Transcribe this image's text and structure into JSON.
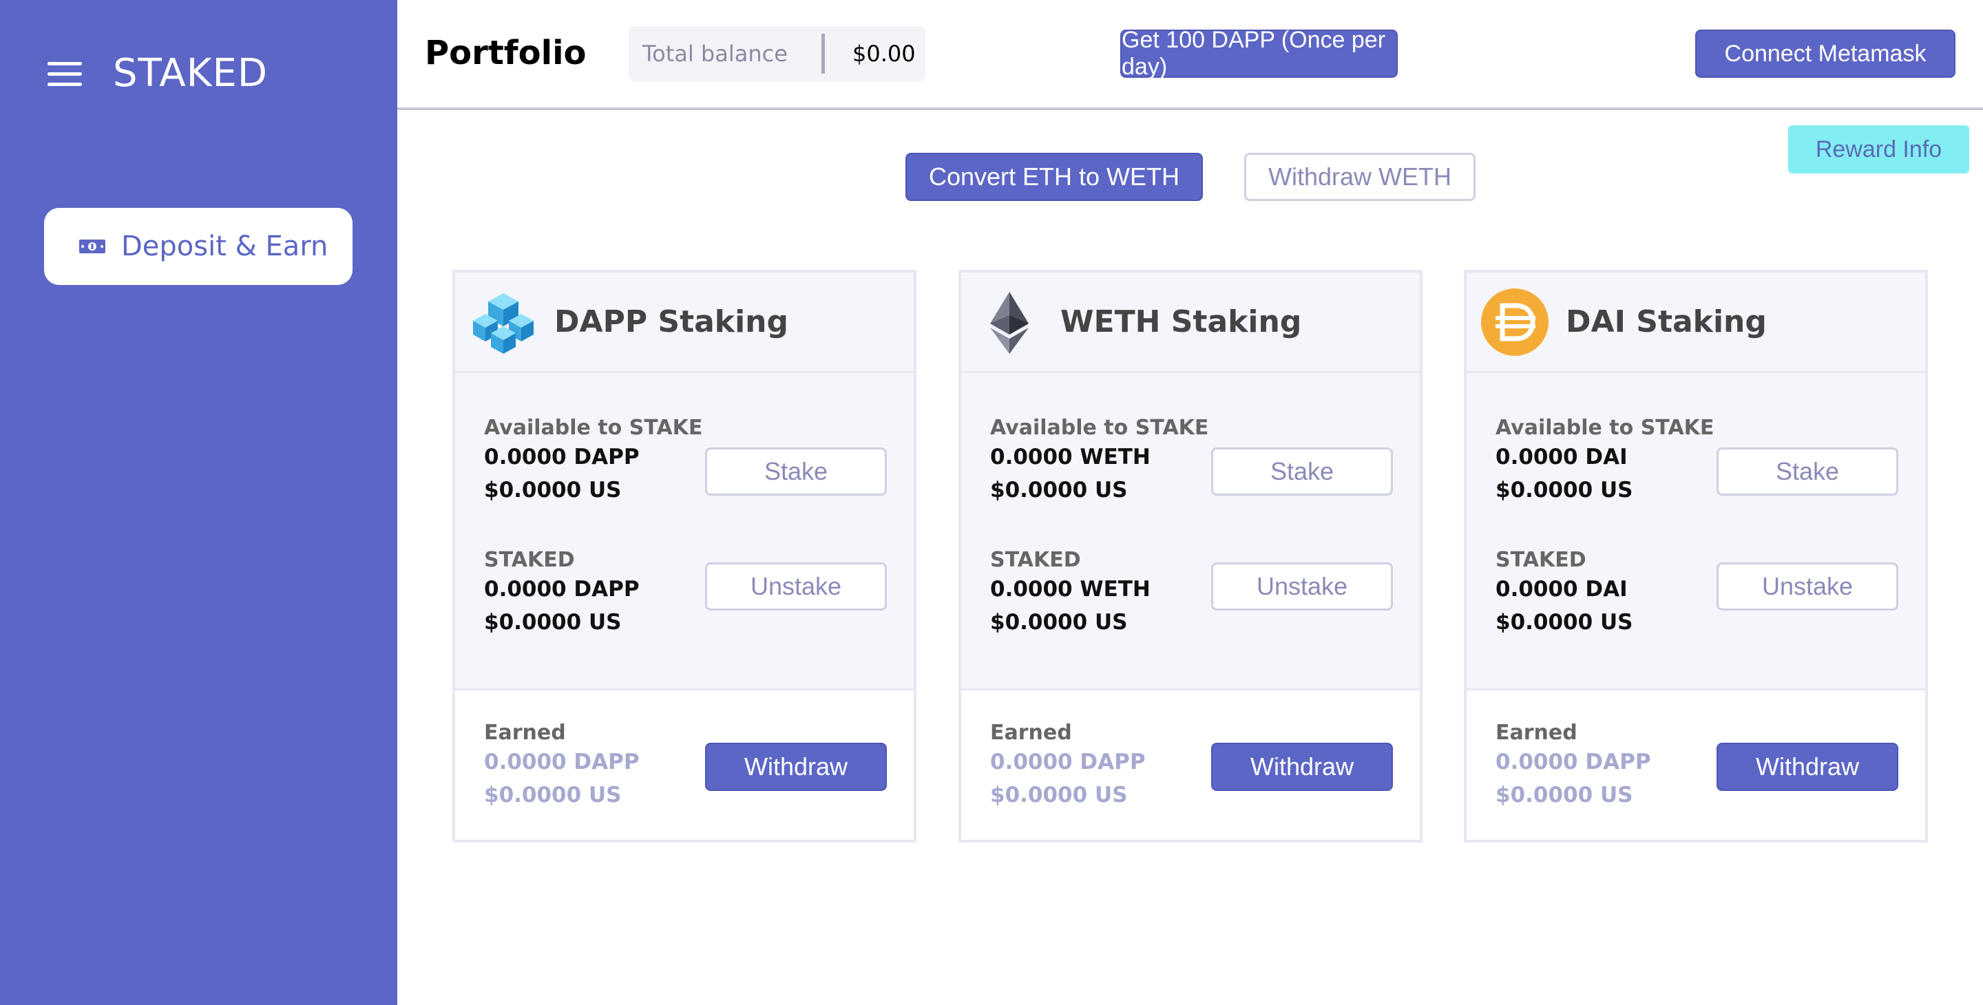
{
  "app": {
    "brand": "STAKED"
  },
  "sidebar": {
    "nav": [
      {
        "label": "Deposit & Earn",
        "icon": "money-bill-icon"
      }
    ]
  },
  "header": {
    "title": "Portfolio",
    "balance_label": "Total balance",
    "balance_value": "$0.00",
    "faucet_button": "Get 100 DAPP (Once per day)",
    "connect_button": "Connect Metamask"
  },
  "actions": {
    "convert": "Convert ETH to WETH",
    "withdraw_weth": "Withdraw WETH",
    "reward_info": "Reward Info"
  },
  "cards": [
    {
      "title": "DAPP Staking",
      "icon": "dapp-cube-icon",
      "available_label": "Available to STAKE",
      "available_amount": "0.0000 DAPP",
      "available_usd": "$0.0000 US",
      "stake_button": "Stake",
      "staked_label": "STAKED",
      "staked_amount": "0.0000 DAPP",
      "staked_usd": "$0.0000 US",
      "unstake_button": "Unstake",
      "earned_label": "Earned",
      "earned_amount": "0.0000 DAPP",
      "earned_usd": "$0.0000 US",
      "withdraw_button": "Withdraw"
    },
    {
      "title": "WETH Staking",
      "icon": "ethereum-icon",
      "available_label": "Available to STAKE",
      "available_amount": "0.0000 WETH",
      "available_usd": "$0.0000 US",
      "stake_button": "Stake",
      "staked_label": "STAKED",
      "staked_amount": "0.0000 WETH",
      "staked_usd": "$0.0000 US",
      "unstake_button": "Unstake",
      "earned_label": "Earned",
      "earned_amount": "0.0000 DAPP",
      "earned_usd": "$0.0000 US",
      "withdraw_button": "Withdraw"
    },
    {
      "title": "DAI Staking",
      "icon": "dai-coin-icon",
      "available_label": "Available to STAKE",
      "available_amount": "0.0000 DAI",
      "available_usd": "$0.0000 US",
      "stake_button": "Stake",
      "staked_label": "STAKED",
      "staked_amount": "0.0000 DAI",
      "staked_usd": "$0.0000 US",
      "unstake_button": "Unstake",
      "earned_label": "Earned",
      "earned_amount": "0.0000 DAPP",
      "earned_usd": "$0.0000 US",
      "withdraw_button": "Withdraw"
    }
  ],
  "colors": {
    "primary": "#5c66c6",
    "accent": "#82eef3",
    "muted_text": "#a6a9cf",
    "card_bg": "#f5f6fb"
  }
}
